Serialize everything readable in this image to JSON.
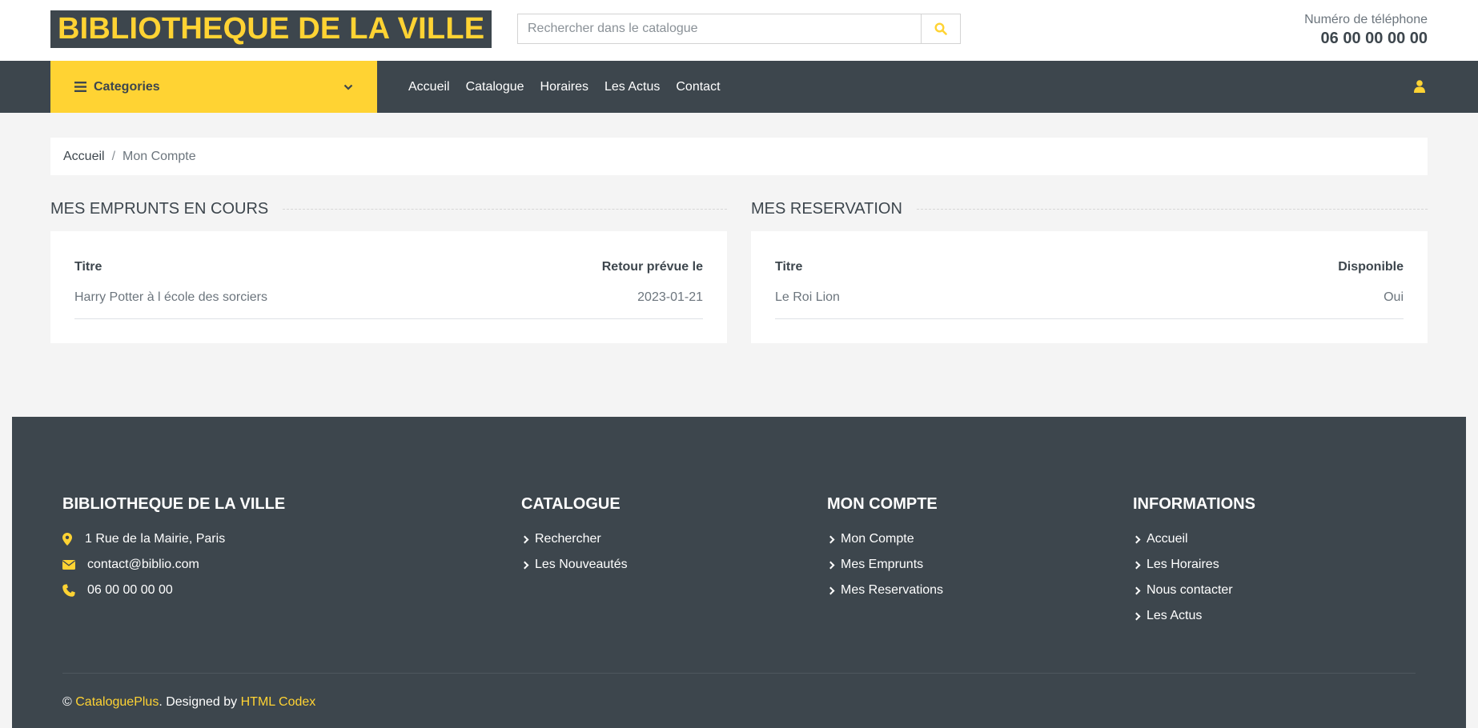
{
  "header": {
    "logo": "BIBLIOTHEQUE DE LA VILLE",
    "search_placeholder": "Rechercher dans le catalogue",
    "phone_label": "Numéro de téléphone",
    "phone_number": "06 00 00 00 00"
  },
  "navbar": {
    "categories_label": "Categories",
    "links": [
      "Accueil",
      "Catalogue",
      "Horaires",
      "Les Actus",
      "Contact"
    ]
  },
  "breadcrumb": {
    "home": "Accueil",
    "separator": "/",
    "current": "Mon Compte"
  },
  "loans": {
    "title": "MES EMPRUNTS EN COURS",
    "headers": [
      "Titre",
      "Retour prévue le"
    ],
    "rows": [
      [
        "Harry Potter à l école des sorciers",
        "2023-01-21"
      ]
    ]
  },
  "reservations": {
    "title": "MES RESERVATION",
    "headers": [
      "Titre",
      "Disponible"
    ],
    "rows": [
      [
        "Le Roi Lion",
        "Oui"
      ]
    ]
  },
  "footer": {
    "library": {
      "title": "BIBLIOTHEQUE DE LA VILLE",
      "address": "1 Rue de la Mairie, Paris",
      "email": "contact@biblio.com",
      "phone": "06 00 00 00 00"
    },
    "catalogue": {
      "title": "CATALOGUE",
      "links": [
        "Rechercher",
        "Les Nouveautés"
      ]
    },
    "account": {
      "title": "MON COMPTE",
      "links": [
        "Mon Compte",
        "Mes Emprunts",
        "Mes Reservations"
      ]
    },
    "info": {
      "title": "INFORMATIONS",
      "links": [
        "Accueil",
        "Les Horaires",
        "Nous contacter",
        "Les Actus"
      ]
    },
    "copyright": {
      "symbol": "©",
      "brand": "CataloguePlus",
      "middle": ". Designed by",
      "designer": "HTML Codex"
    }
  },
  "colors": {
    "accent": "#ffd333",
    "dark": "#3d464d",
    "background": "#f4f4f4"
  }
}
